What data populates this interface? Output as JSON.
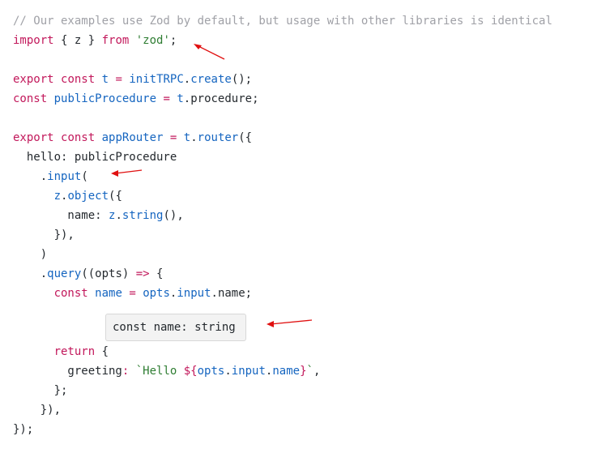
{
  "colors": {
    "comment": "#a0a1a7",
    "keyword": "#c2185b",
    "string": "#2e7d32",
    "function": "#1565c0",
    "annotation_arrow": "#e01010",
    "tooltip_bg": "#f3f3f3"
  },
  "code": {
    "lines": [
      {
        "tokens": [
          {
            "t": "// Our examples use Zod by default, but usage with other libraries is identical",
            "k": "comment"
          }
        ]
      },
      {
        "tokens": [
          {
            "t": "import",
            "k": "keyword"
          },
          {
            "t": " { z } ",
            "k": "plain"
          },
          {
            "t": "from",
            "k": "keyword"
          },
          {
            "t": " ",
            "k": "plain"
          },
          {
            "t": "'zod'",
            "k": "string"
          },
          {
            "t": ";",
            "k": "plain"
          }
        ]
      },
      {
        "tokens": []
      },
      {
        "tokens": [
          {
            "t": "export",
            "k": "keyword"
          },
          {
            "t": " ",
            "k": "plain"
          },
          {
            "t": "const",
            "k": "keyword"
          },
          {
            "t": " ",
            "k": "plain"
          },
          {
            "t": "t",
            "k": "var"
          },
          {
            "t": " ",
            "k": "plain"
          },
          {
            "t": "=",
            "k": "op"
          },
          {
            "t": " ",
            "k": "plain"
          },
          {
            "t": "initTRPC",
            "k": "fn"
          },
          {
            "t": ".",
            "k": "plain"
          },
          {
            "t": "create",
            "k": "fn"
          },
          {
            "t": "();",
            "k": "plain"
          }
        ]
      },
      {
        "tokens": [
          {
            "t": "const",
            "k": "keyword"
          },
          {
            "t": " ",
            "k": "plain"
          },
          {
            "t": "publicProcedure",
            "k": "var"
          },
          {
            "t": " ",
            "k": "plain"
          },
          {
            "t": "=",
            "k": "op"
          },
          {
            "t": " ",
            "k": "plain"
          },
          {
            "t": "t",
            "k": "var"
          },
          {
            "t": ".procedure;",
            "k": "plain"
          }
        ]
      },
      {
        "tokens": []
      },
      {
        "tokens": [
          {
            "t": "export",
            "k": "keyword"
          },
          {
            "t": " ",
            "k": "plain"
          },
          {
            "t": "const",
            "k": "keyword"
          },
          {
            "t": " ",
            "k": "plain"
          },
          {
            "t": "appRouter",
            "k": "var"
          },
          {
            "t": " ",
            "k": "plain"
          },
          {
            "t": "=",
            "k": "op"
          },
          {
            "t": " ",
            "k": "plain"
          },
          {
            "t": "t",
            "k": "var"
          },
          {
            "t": ".",
            "k": "plain"
          },
          {
            "t": "router",
            "k": "fn"
          },
          {
            "t": "({",
            "k": "plain"
          }
        ]
      },
      {
        "tokens": [
          {
            "t": "  hello: publicProcedure",
            "k": "plain"
          }
        ]
      },
      {
        "tokens": [
          {
            "t": "    .",
            "k": "plain"
          },
          {
            "t": "input",
            "k": "fn"
          },
          {
            "t": "(",
            "k": "plain"
          }
        ]
      },
      {
        "tokens": [
          {
            "t": "      ",
            "k": "plain"
          },
          {
            "t": "z",
            "k": "var"
          },
          {
            "t": ".",
            "k": "plain"
          },
          {
            "t": "object",
            "k": "fn"
          },
          {
            "t": "({",
            "k": "plain"
          }
        ]
      },
      {
        "tokens": [
          {
            "t": "        name: ",
            "k": "plain"
          },
          {
            "t": "z",
            "k": "var"
          },
          {
            "t": ".",
            "k": "plain"
          },
          {
            "t": "string",
            "k": "fn"
          },
          {
            "t": "(),",
            "k": "plain"
          }
        ]
      },
      {
        "tokens": [
          {
            "t": "      }),",
            "k": "plain"
          }
        ]
      },
      {
        "tokens": [
          {
            "t": "    )",
            "k": "plain"
          }
        ]
      },
      {
        "tokens": [
          {
            "t": "    .",
            "k": "plain"
          },
          {
            "t": "query",
            "k": "fn"
          },
          {
            "t": "((opts) ",
            "k": "plain"
          },
          {
            "t": "=>",
            "k": "op"
          },
          {
            "t": " {",
            "k": "plain"
          }
        ]
      },
      {
        "tokens": [
          {
            "t": "      ",
            "k": "plain"
          },
          {
            "t": "const",
            "k": "keyword"
          },
          {
            "t": " ",
            "k": "plain"
          },
          {
            "t": "name",
            "k": "var"
          },
          {
            "t": " ",
            "k": "plain"
          },
          {
            "t": "=",
            "k": "op"
          },
          {
            "t": " ",
            "k": "plain"
          },
          {
            "t": "opts",
            "k": "var"
          },
          {
            "t": ".",
            "k": "plain"
          },
          {
            "t": "input",
            "k": "var"
          },
          {
            "t": ".name;",
            "k": "plain"
          }
        ]
      },
      {
        "tokens": []
      },
      {
        "tokens": []
      },
      {
        "tokens": [
          {
            "t": "      ",
            "k": "plain"
          },
          {
            "t": "return",
            "k": "keyword"
          },
          {
            "t": " {",
            "k": "plain"
          }
        ]
      },
      {
        "tokens": [
          {
            "t": "        greeting",
            "k": "plain"
          },
          {
            "t": ":",
            "k": "op"
          },
          {
            "t": " ",
            "k": "plain"
          },
          {
            "t": "`Hello ",
            "k": "string"
          },
          {
            "t": "${",
            "k": "keyword"
          },
          {
            "t": "opts",
            "k": "var"
          },
          {
            "t": ".",
            "k": "plain"
          },
          {
            "t": "input",
            "k": "var"
          },
          {
            "t": ".",
            "k": "plain"
          },
          {
            "t": "name",
            "k": "var"
          },
          {
            "t": "}",
            "k": "keyword"
          },
          {
            "t": "`",
            "k": "string"
          },
          {
            "t": ",",
            "k": "plain"
          }
        ]
      },
      {
        "tokens": [
          {
            "t": "      };",
            "k": "plain"
          }
        ]
      },
      {
        "tokens": [
          {
            "t": "    }),",
            "k": "plain"
          }
        ]
      },
      {
        "tokens": [
          {
            "t": "});",
            "k": "plain"
          }
        ]
      }
    ]
  },
  "tooltip": {
    "text": "const name: string"
  }
}
